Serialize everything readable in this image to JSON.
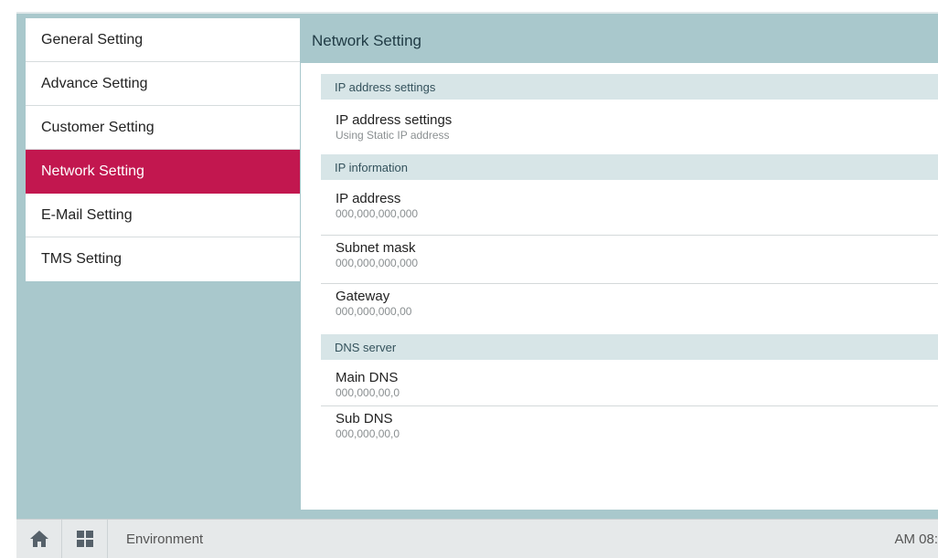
{
  "sidebar": {
    "items": [
      {
        "label": "General Setting"
      },
      {
        "label": "Advance Setting"
      },
      {
        "label": "Customer Setting"
      },
      {
        "label": "Network Setting"
      },
      {
        "label": "E-Mail Setting"
      },
      {
        "label": "TMS Setting"
      }
    ],
    "active_index": 3
  },
  "main": {
    "title": "Network Setting",
    "sections": [
      {
        "header": "IP address settings",
        "items": [
          {
            "title": "IP address settings",
            "value": "Using Static IP address"
          }
        ]
      },
      {
        "header": "IP information",
        "items": [
          {
            "title": "IP address",
            "value": "000,000,000,000"
          },
          {
            "title": "Subnet mask",
            "value": "000,000,000,000"
          },
          {
            "title": "Gateway",
            "value": "000,000,000,00"
          }
        ]
      },
      {
        "header": "DNS server",
        "items": [
          {
            "title": "Main DNS",
            "value": "000,000,00,0"
          },
          {
            "title": "Sub DNS",
            "value": "000,000,00,0"
          }
        ]
      }
    ]
  },
  "bottombar": {
    "home_icon": "home-icon",
    "apps_icon": "grid-icon",
    "title": "Environment",
    "time": "AM 08:"
  },
  "colors": {
    "accent": "#c2174f",
    "header_bg": "#a9c8cc",
    "section_bg": "#d7e5e7"
  }
}
